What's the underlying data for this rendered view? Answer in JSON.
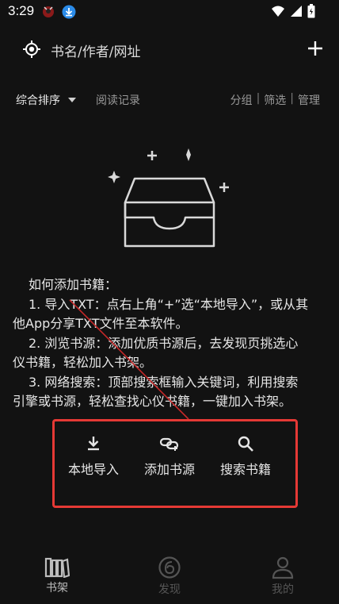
{
  "status": {
    "time": "3:29"
  },
  "search": {
    "placeholder": "书名/作者/网址"
  },
  "toolbar": {
    "sort_label": "综合排序",
    "history_label": "阅读记录",
    "group_label": "分组",
    "filter_label": "筛选",
    "manage_label": "管理",
    "separator": "|"
  },
  "help": {
    "title": "如何添加书籍：",
    "lines": [
      "1. 导入TXT：点右上角“+”选“本地导入”，或从其",
      "他App分享TXT文件至本软件。",
      "2. 浏览书源：添加优质书源后，去发现页挑选心",
      "仪书籍，轻松加入书架。",
      "3. 网络搜索：顶部搜索框输入关键词，利用搜索",
      "引擎或书源，轻松查找心仪书籍，一键加入书架。"
    ]
  },
  "actions": {
    "import_label": "本地导入",
    "add_source_label": "添加书源",
    "search_label": "搜索书籍"
  },
  "nav": {
    "shelf_label": "书架",
    "discover_label": "发现",
    "me_label": "我的"
  },
  "colors": {
    "background": "#121212",
    "highlight_box": "#e53935",
    "nav_active": "#bdbdbd",
    "nav_inactive": "#555555"
  }
}
